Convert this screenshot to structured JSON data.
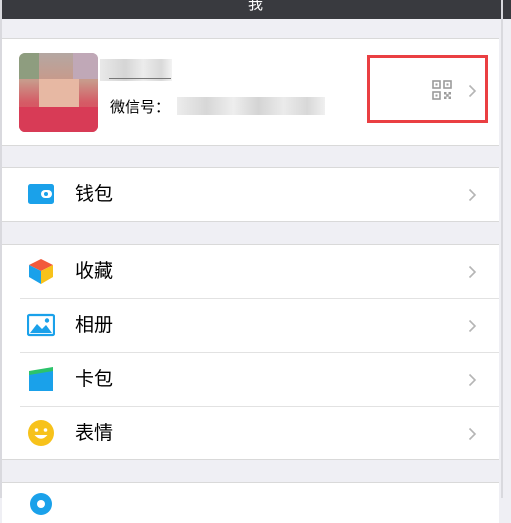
{
  "title_bar": {
    "title": "我"
  },
  "profile": {
    "wechat_id_label": "微信号：",
    "avatar_icon": "avatar-photo",
    "qr_icon": "qr-code-icon",
    "highlight_color": "#ea3f42"
  },
  "menu": {
    "wallet": {
      "label": "钱包",
      "icon": "wallet-icon"
    },
    "favorites": {
      "label": "收藏",
      "icon": "cube-icon"
    },
    "album": {
      "label": "相册",
      "icon": "photo-icon"
    },
    "cards": {
      "label": "卡包",
      "icon": "card-icon"
    },
    "stickers": {
      "label": "表情",
      "icon": "smiley-icon"
    }
  },
  "colors": {
    "background": "#efeff4",
    "title_bar": "#393a3f",
    "accent_blue": "#1aa1ea",
    "sticker_yellow": "#f7c21b"
  }
}
